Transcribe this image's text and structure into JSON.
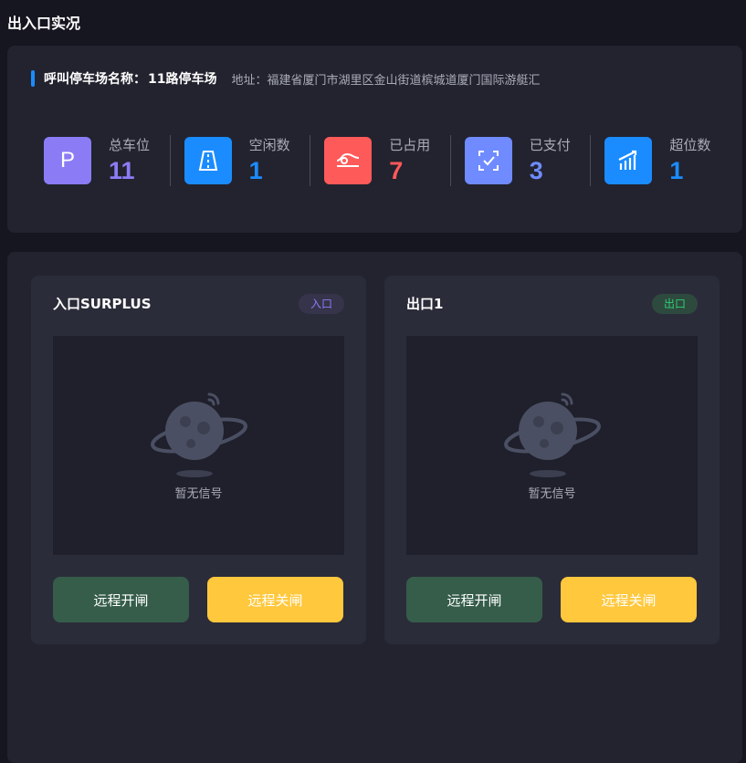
{
  "page": {
    "title": "出入口实况"
  },
  "lot": {
    "name_label": "呼叫停车场名称：",
    "name": "11路停车场",
    "address_label": "地址：",
    "address": "福建省厦门市湖里区金山街道槟城道厦门国际游艇汇"
  },
  "stats": [
    {
      "label": "总车位",
      "value": "11",
      "color": "#8b7cf6",
      "icon": "parking-icon",
      "icon_glyph": "P"
    },
    {
      "label": "空闲数",
      "value": "1",
      "color": "#1b8cff",
      "icon": "road-icon"
    },
    {
      "label": "已占用",
      "value": "7",
      "color": "#ff5a5a",
      "icon": "car-occupied-icon"
    },
    {
      "label": "已支付",
      "value": "3",
      "color": "#6f8bff",
      "icon": "paid-check-icon"
    },
    {
      "label": "超位数",
      "value": "1",
      "color": "#1b8cff",
      "icon": "chart-bars-icon"
    }
  ],
  "gates": [
    {
      "title": "入口SURPLUS",
      "tag": "入口",
      "tag_color": "#8b7cf6",
      "tag_bg": "#35344a",
      "no_signal": "暂无信号",
      "open_label": "远程开闸",
      "close_label": "远程关闸"
    },
    {
      "title": "出口1",
      "tag": "出口",
      "tag_color": "#2ecc71",
      "tag_bg": "#2e4a3f",
      "no_signal": "暂无信号",
      "open_label": "远程开闸",
      "close_label": "远程关闸"
    }
  ]
}
